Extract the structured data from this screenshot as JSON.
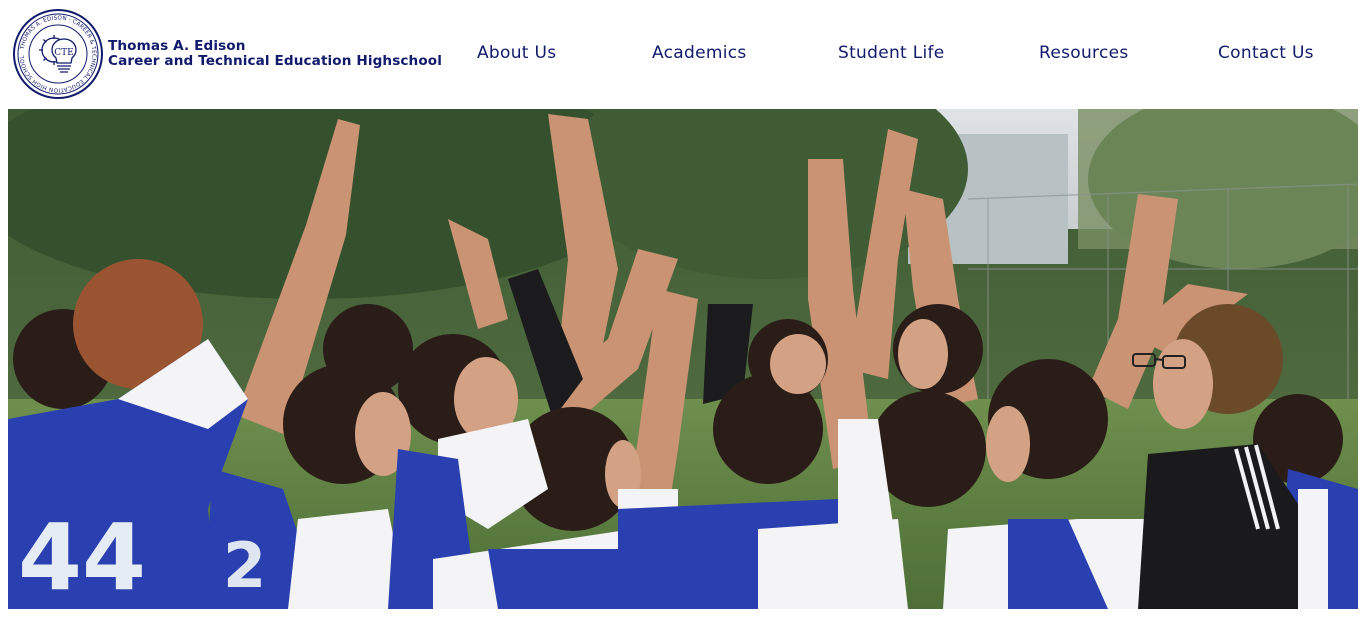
{
  "header": {
    "logo": {
      "ring_text": "THOMAS A. EDISON · CAREER & TECHNICAL EDUCATION HIGH SCHOOL",
      "monogram": "CTE",
      "icon": "lightbulb-gear-seal-icon"
    },
    "school_name_line1": "Thomas A. Edison",
    "school_name_line2": "Career and Technical Education Highschool"
  },
  "nav": {
    "items": [
      {
        "label": "About Us"
      },
      {
        "label": "Academics"
      },
      {
        "label": "Student Life"
      },
      {
        "label": "Resources"
      },
      {
        "label": "Contact Us"
      }
    ]
  },
  "hero": {
    "image": "girls-soccer-team-high-five-huddle-photo",
    "jersey_numbers": [
      "44",
      "2"
    ]
  },
  "colors": {
    "brand_navy": "#111a6b",
    "jersey_blue": "#2a3fb0",
    "background": "#ffffff"
  }
}
